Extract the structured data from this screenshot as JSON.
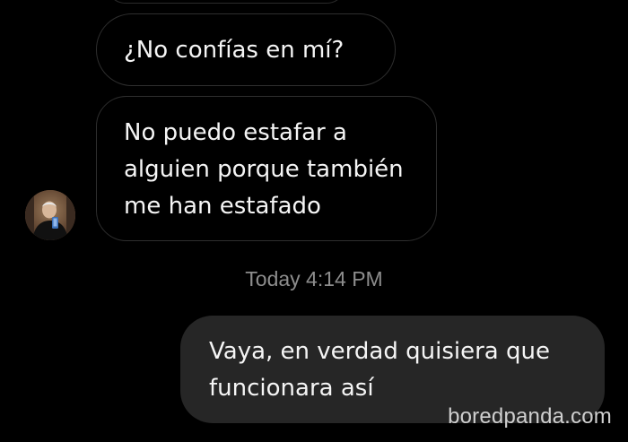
{
  "conversation": {
    "incoming_1": "¿No confías en mí?",
    "incoming_2_lines": [
      "No puedo estafar a",
      "alguien porque también",
      "me han estafado"
    ],
    "timestamp": "Today 4:14 PM",
    "outgoing_lines": [
      "Vaya, en verdad quisiera que",
      "funcionara así"
    ]
  },
  "watermark": "boredpanda.com",
  "colors": {
    "background": "#000000",
    "incoming_border": "#2e2e2e",
    "outgoing_bubble": "#262626",
    "timestamp": "#8d8d8d"
  }
}
